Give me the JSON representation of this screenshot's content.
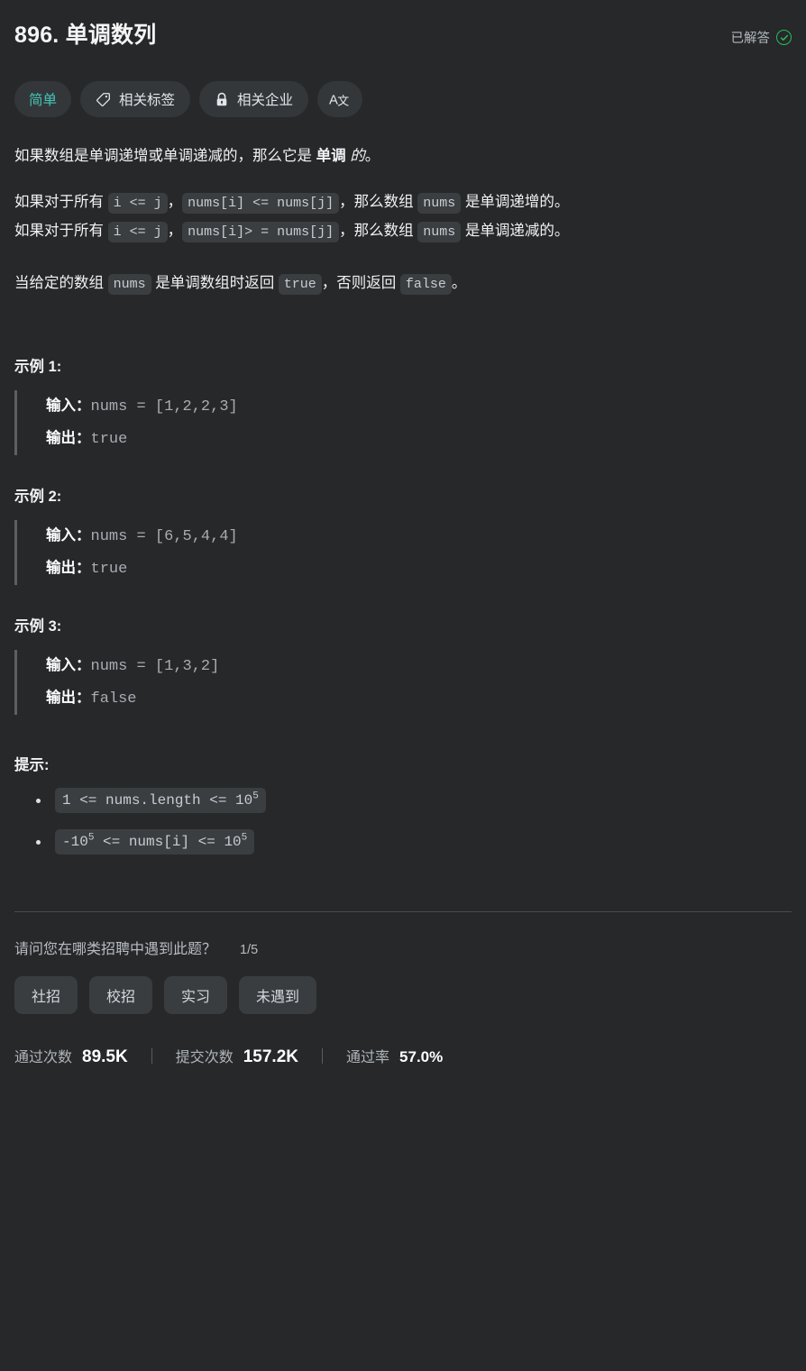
{
  "header": {
    "title": "896. 单调数列",
    "status_label": "已解答",
    "status_icon": "check-circle-icon",
    "status_color": "#2cbb5d"
  },
  "tags": [
    {
      "label": "简单",
      "icon": null,
      "color": "#43c4b6"
    },
    {
      "label": "相关标签",
      "icon": "tag-icon"
    },
    {
      "label": "相关企业",
      "icon": "lock-icon"
    },
    {
      "label": "",
      "icon": "translate-icon"
    }
  ],
  "description": {
    "line1_pre": "如果数组是单调递增或单调递减的，那么它是 ",
    "line1_bold": "单调",
    "line1_mid": " ",
    "line1_italic": "的",
    "line1_post": "。",
    "line2_pre": "如果对于所有 ",
    "line2_code1": "i <= j",
    "line2_mid1": "，",
    "line2_code2": "nums[i] <= nums[j]",
    "line2_mid2": "，那么数组 ",
    "line2_code3": "nums",
    "line2_post": " 是单调递增的。",
    "line3_pre": "如果对于所有 ",
    "line3_code1": "i <= j",
    "line3_mid1": "，",
    "line3_code2": "nums[i]> = nums[j]",
    "line3_mid2": "，那么数组 ",
    "line3_code3": "nums",
    "line3_post": " 是单调递减的。",
    "line4_pre": "当给定的数组 ",
    "line4_code1": "nums",
    "line4_mid1": " 是单调数组时返回 ",
    "line4_code2": "true",
    "line4_mid2": "，否则返回 ",
    "line4_code3": "false",
    "line4_post": "。"
  },
  "examples": [
    {
      "title": "示例 1:",
      "input_label": "输入：",
      "input_value": "nums = [1,2,2,3]",
      "output_label": "输出：",
      "output_value": "true"
    },
    {
      "title": "示例 2:",
      "input_label": "输入：",
      "input_value": "nums = [6,5,4,4]",
      "output_label": "输出：",
      "output_value": "true"
    },
    {
      "title": "示例 3:",
      "input_label": "输入：",
      "input_value": "nums = [1,3,2]",
      "output_label": "输出：",
      "output_value": "false"
    }
  ],
  "hints": {
    "title": "提示:",
    "items": [
      {
        "pre": "1 <= nums.length <= 10",
        "sup": "5",
        "post": ""
      },
      {
        "pre": "-10",
        "sup": "5",
        "post": " <= nums[i] <= 10",
        "sup2": "5"
      }
    ]
  },
  "survey": {
    "question": "请问您在哪类招聘中遇到此题？",
    "counter": "1/5",
    "options": [
      "社招",
      "校招",
      "实习",
      "未遇到"
    ]
  },
  "stats": [
    {
      "label": "通过次数",
      "value": "89.5K"
    },
    {
      "label": "提交次数",
      "value": "157.2K"
    },
    {
      "label": "通过率",
      "value": "57.0%"
    }
  ]
}
